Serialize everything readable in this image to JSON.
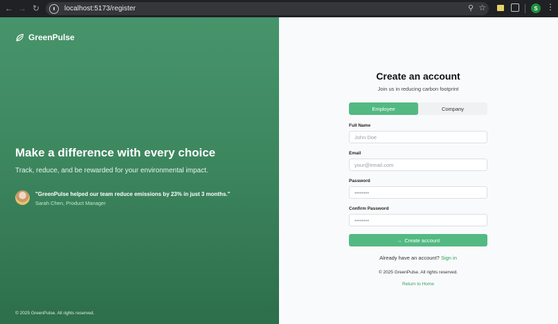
{
  "browser": {
    "url": "localhost:5173/register",
    "profile_initial": "S"
  },
  "hero": {
    "brand": "GreenPulse",
    "title": "Make a difference with every choice",
    "subtitle": "Track, reduce, and be rewarded for your environmental impact.",
    "quote": "\"GreenPulse helped our team reduce emissions by 23% in just 3 months.\"",
    "author": "Sarah Chen, Product Manager",
    "footer": "© 2025 GreenPulse. All rights reserved."
  },
  "form": {
    "title": "Create an account",
    "subtitle": "Join us in reducing carbon footprint",
    "tabs": [
      {
        "label": "Employee",
        "active": true
      },
      {
        "label": "Company",
        "active": false
      }
    ],
    "fields": {
      "full_name": {
        "label": "Full Name",
        "placeholder": "John Doe"
      },
      "email": {
        "label": "Email",
        "placeholder": "your@email.com"
      },
      "password": {
        "label": "Password",
        "placeholder": "••••••••"
      },
      "confirm_password": {
        "label": "Confirm Password",
        "placeholder": "••••••••"
      }
    },
    "submit_label": "Create account",
    "signin_prompt": "Already have an account?",
    "signin_link": "Sign in",
    "copyright": "© 2025 GreenPulse. All rights reserved.",
    "return_home": "Return to Home"
  },
  "colors": {
    "accent": "#52b983",
    "hero_top": "#47946b",
    "hero_bottom": "#2d6e4b",
    "link": "#2f9e62"
  }
}
